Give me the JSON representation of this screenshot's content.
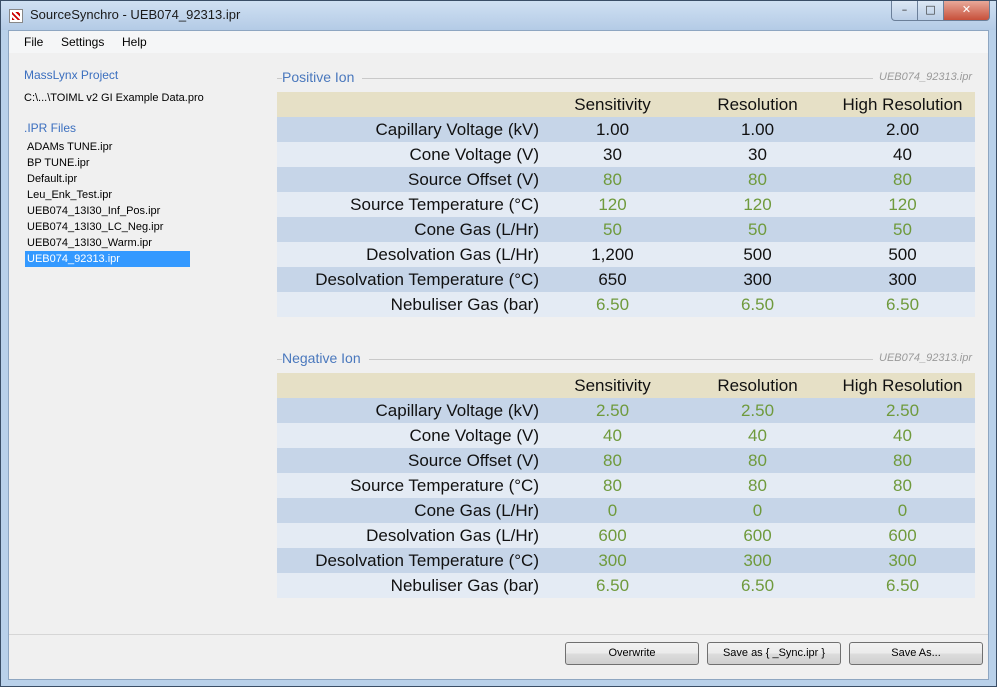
{
  "window": {
    "title": "SourceSynchro - UEB074_92313.ipr",
    "minimize_glyph": "–",
    "maximize_glyph": "□",
    "close_glyph": "✕"
  },
  "menu": [
    "File",
    "Settings",
    "Help"
  ],
  "sidebar": {
    "project_heading": "MassLynx Project",
    "project_path": "C:\\...\\TOIML v2 GI Example Data.pro",
    "files_heading": ".IPR Files",
    "files": [
      "ADAMs TUNE.ipr",
      "BP TUNE.ipr",
      "Default.ipr",
      "Leu_Enk_Test.ipr",
      "UEB074_13I30_Inf_Pos.ipr",
      "UEB074_13I30_LC_Neg.ipr",
      "UEB074_13I30_Warm.ipr",
      "UEB074_92313.ipr"
    ],
    "selected_index": 7
  },
  "columns": [
    "Sensitivity",
    "Resolution",
    "High Resolution"
  ],
  "positive": {
    "title": "Positive Ion",
    "file": "UEB074_92313.ipr",
    "rows": [
      {
        "label": "Capillary Voltage (kV)",
        "values": [
          "1.00",
          "1.00",
          "2.00"
        ],
        "states": [
          "changed",
          "changed",
          "changed"
        ]
      },
      {
        "label": "Cone Voltage (V)",
        "values": [
          "30",
          "30",
          "40"
        ],
        "states": [
          "changed",
          "changed",
          "changed"
        ]
      },
      {
        "label": "Source Offset (V)",
        "values": [
          "80",
          "80",
          "80"
        ],
        "states": [
          "default",
          "default",
          "default"
        ]
      },
      {
        "label": "Source Temperature (°C)",
        "values": [
          "120",
          "120",
          "120"
        ],
        "states": [
          "default",
          "default",
          "default"
        ]
      },
      {
        "label": "Cone Gas (L/Hr)",
        "values": [
          "50",
          "50",
          "50"
        ],
        "states": [
          "default",
          "default",
          "default"
        ]
      },
      {
        "label": "Desolvation Gas (L/Hr)",
        "values": [
          "1,200",
          "500",
          "500"
        ],
        "states": [
          "changed",
          "changed",
          "changed"
        ]
      },
      {
        "label": "Desolvation Temperature (°C)",
        "values": [
          "650",
          "300",
          "300"
        ],
        "states": [
          "changed",
          "changed",
          "changed"
        ]
      },
      {
        "label": "Nebuliser Gas (bar)",
        "values": [
          "6.50",
          "6.50",
          "6.50"
        ],
        "states": [
          "default",
          "default",
          "default"
        ]
      }
    ]
  },
  "negative": {
    "title": "Negative Ion",
    "file": "UEB074_92313.ipr",
    "rows": [
      {
        "label": "Capillary Voltage (kV)",
        "values": [
          "2.50",
          "2.50",
          "2.50"
        ],
        "states": [
          "default",
          "default",
          "default"
        ]
      },
      {
        "label": "Cone Voltage (V)",
        "values": [
          "40",
          "40",
          "40"
        ],
        "states": [
          "default",
          "default",
          "default"
        ]
      },
      {
        "label": "Source Offset (V)",
        "values": [
          "80",
          "80",
          "80"
        ],
        "states": [
          "default",
          "default",
          "default"
        ]
      },
      {
        "label": "Source Temperature (°C)",
        "values": [
          "80",
          "80",
          "80"
        ],
        "states": [
          "default",
          "default",
          "default"
        ]
      },
      {
        "label": "Cone Gas (L/Hr)",
        "values": [
          "0",
          "0",
          "0"
        ],
        "states": [
          "default",
          "default",
          "default"
        ]
      },
      {
        "label": "Desolvation Gas (L/Hr)",
        "values": [
          "600",
          "600",
          "600"
        ],
        "states": [
          "default",
          "default",
          "default"
        ]
      },
      {
        "label": "Desolvation Temperature (°C)",
        "values": [
          "300",
          "300",
          "300"
        ],
        "states": [
          "default",
          "default",
          "default"
        ]
      },
      {
        "label": "Nebuliser Gas (bar)",
        "values": [
          "6.50",
          "6.50",
          "6.50"
        ],
        "states": [
          "default",
          "default",
          "default"
        ]
      }
    ]
  },
  "buttons": {
    "overwrite": "Overwrite",
    "save_sync": "Save as { _Sync.ipr }",
    "save_as": "Save As..."
  },
  "colors": {
    "default_value": "#6f9a3c",
    "changed_value": "#111111",
    "header_band": "#e6e0c6",
    "row_band": "#c6d5e8",
    "row_plain": "#e4ebf4",
    "heading_blue": "#4a78bd",
    "selection": "#3399ff"
  }
}
